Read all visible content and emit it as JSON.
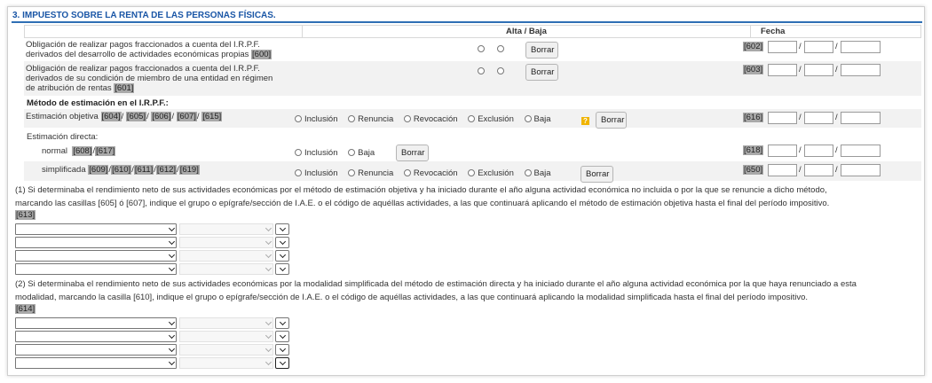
{
  "section_title": "3. IMPUESTO SOBRE LA RENTA DE LAS PERSONAS FÍSICAS.",
  "header": {
    "alta_baja": "Alta / Baja",
    "fecha": "Fecha"
  },
  "rows": {
    "r600": {
      "line1": "Obligación de realizar pagos fraccionados a cuenta del I.R.P.F.",
      "line2": "derivados del desarrollo de actividades económicas propias",
      "code": "[600]",
      "date_code": "[602]"
    },
    "r601": {
      "line1": "Obligación de realizar pagos fraccionados a cuenta del I.R.P.F.",
      "line2": "derivados de su condición de miembro de una entidad en régimen",
      "line3": "de atribución de rentas",
      "code": "[601]",
      "date_code": "[603]"
    },
    "metodo_title": "Método de estimación en el I.R.P.F.:",
    "objetiva": {
      "label": "Estimación objetiva",
      "codes": [
        "[604]",
        "[605]",
        "[606]",
        "[607]",
        "[615]"
      ],
      "date_code": "[616]"
    },
    "directa_title": "Estimación directa:",
    "normal": {
      "label": "normal",
      "codes": [
        "[608]",
        "[617]"
      ],
      "date_code": "[618]"
    },
    "simplificada": {
      "label": "simplificada",
      "codes": [
        "[609]",
        "[610]",
        "[611]",
        "[612]",
        "[619]"
      ],
      "date_code": "[650]"
    }
  },
  "options": {
    "inclusion": "Inclusión",
    "renuncia": "Renuncia",
    "revocacion": "Revocación",
    "exclusion": "Exclusión",
    "baja": "Baja"
  },
  "buttons": {
    "borrar": "Borrar"
  },
  "help_icon_glyph": "?",
  "slash": "/",
  "note1": {
    "line1": "(1) Si determinaba el rendimiento neto de sus actividades económicas por el método de estimación objetiva y ha iniciado durante el año alguna actividad económica no incluida o por la que se renuncie a dicho método,",
    "line2": "marcando las casillas [605] ó [607], indique el grupo o epígrafe/sección de I.A.E. o el código de aquéllas actividades, a las que continuará aplicando el método de estimación objetiva hasta el final del período impositivo.",
    "code": "[613]"
  },
  "note2": {
    "line1": "(2) Si determinaba el rendimiento neto de sus actividades económicas por la modalidad simplificada del método de estimación directa y ha iniciado durante el año alguna actividad económica por la que haya renunciado a esta",
    "line2": "modalidad, marcando la casilla [610], indique el grupo o epígrafe/sección de I.A.E. o el código de aquéllas actividades, a las que continuará aplicando la modalidad simplificada hasta el final del período impositivo.",
    "code": "[614]"
  },
  "colors": {
    "title": "#1a56a6",
    "title_rule": "#2f6fb5",
    "code_bg": "#a9a9a9",
    "help": "#f0b400"
  }
}
